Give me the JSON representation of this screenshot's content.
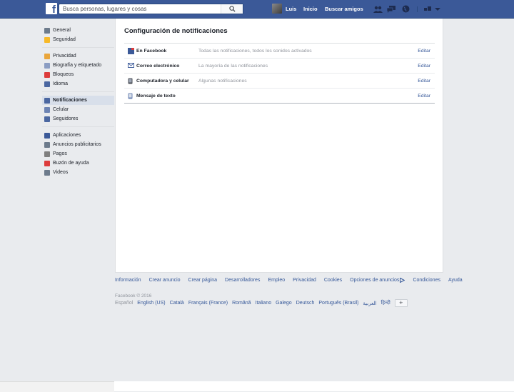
{
  "topbar": {
    "logo": "f",
    "search_placeholder": "Busca personas, lugares y cosas",
    "user_name": "Luis",
    "home_label": "Inicio",
    "find_friends_label": "Buscar amigos"
  },
  "sidebar": {
    "groups": [
      [
        {
          "label": "General",
          "icon": "gears-icon",
          "color": "#6d7b8c"
        },
        {
          "label": "Seguridad",
          "icon": "shield-icon",
          "color": "#f7b928"
        }
      ],
      [
        {
          "label": "Privacidad",
          "icon": "lock-icon",
          "color": "#e9a53b"
        },
        {
          "label": "Biografía y etiquetado",
          "icon": "timeline-icon",
          "color": "#8b9dc3"
        },
        {
          "label": "Bloqueos",
          "icon": "block-icon",
          "color": "#dd3c3c"
        },
        {
          "label": "Idioma",
          "icon": "language-icon",
          "color": "#4b67a1"
        }
      ],
      [
        {
          "label": "Notificaciones",
          "icon": "globe-icon",
          "color": "#4b67a1",
          "active": true
        },
        {
          "label": "Celular",
          "icon": "mobile-icon",
          "color": "#6d84b4"
        },
        {
          "label": "Seguidores",
          "icon": "rss-icon",
          "color": "#4b67a1"
        }
      ],
      [
        {
          "label": "Aplicaciones",
          "icon": "apps-icon",
          "color": "#3b5998"
        },
        {
          "label": "Anuncios publicitarios",
          "icon": "ads-icon",
          "color": "#6d7b8c"
        },
        {
          "label": "Pagos",
          "icon": "payments-icon",
          "color": "#7f7f7f"
        },
        {
          "label": "Buzón de ayuda",
          "icon": "help-icon",
          "color": "#dd3c3c"
        },
        {
          "label": "Videos",
          "icon": "video-icon",
          "color": "#6d7b8c"
        }
      ]
    ]
  },
  "content": {
    "title": "Configuración de notificaciones",
    "rows": [
      {
        "label": "En Facebook",
        "desc": "Todas las notificaciones, todos los sonidos activados",
        "edit": "Editar",
        "icon": "facebook-icon"
      },
      {
        "label": "Correo electrónico",
        "desc": "La mayoría de las notificaciones",
        "edit": "Editar",
        "icon": "email-icon"
      },
      {
        "label": "Computadora y celular",
        "desc": "Algunas notificaciones",
        "edit": "Editar",
        "icon": "device-icon"
      },
      {
        "label": "Mensaje de texto",
        "desc": "",
        "edit": "Editar",
        "icon": "sms-icon"
      }
    ]
  },
  "footer": {
    "links": [
      "Información",
      "Crear anuncio",
      "Crear página",
      "Desarrolladores",
      "Empleo",
      "Privacidad",
      "Cookies",
      "Opciones de anuncios",
      "Condiciones",
      "Ayuda"
    ],
    "copyright": "Facebook © 2016",
    "languages": [
      "Español",
      "English (US)",
      "Català",
      "Français (France)",
      "Română",
      "Italiano",
      "Galego",
      "Deutsch",
      "Português (Brasil)",
      "العربية",
      "हिन्दी"
    ],
    "more_languages": "+"
  }
}
